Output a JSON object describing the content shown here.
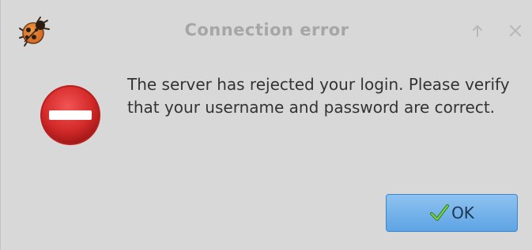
{
  "window": {
    "title": "Connection error",
    "app_icon": "ladybug-icon",
    "controls": {
      "up_icon": "arrow-up-icon",
      "close_icon": "close-icon"
    }
  },
  "dialog": {
    "icon": "error-no-entry-icon",
    "message": "The server has rejected your login. Please verify that your username and password are correct.",
    "ok_label": "OK",
    "ok_icon": "checkmark-icon"
  },
  "colors": {
    "background": "#d8d8d8",
    "title_text": "#a6a6a6",
    "message_text": "#333333",
    "button_accent": "#6aaee6",
    "error_red": "#d42a2a"
  }
}
